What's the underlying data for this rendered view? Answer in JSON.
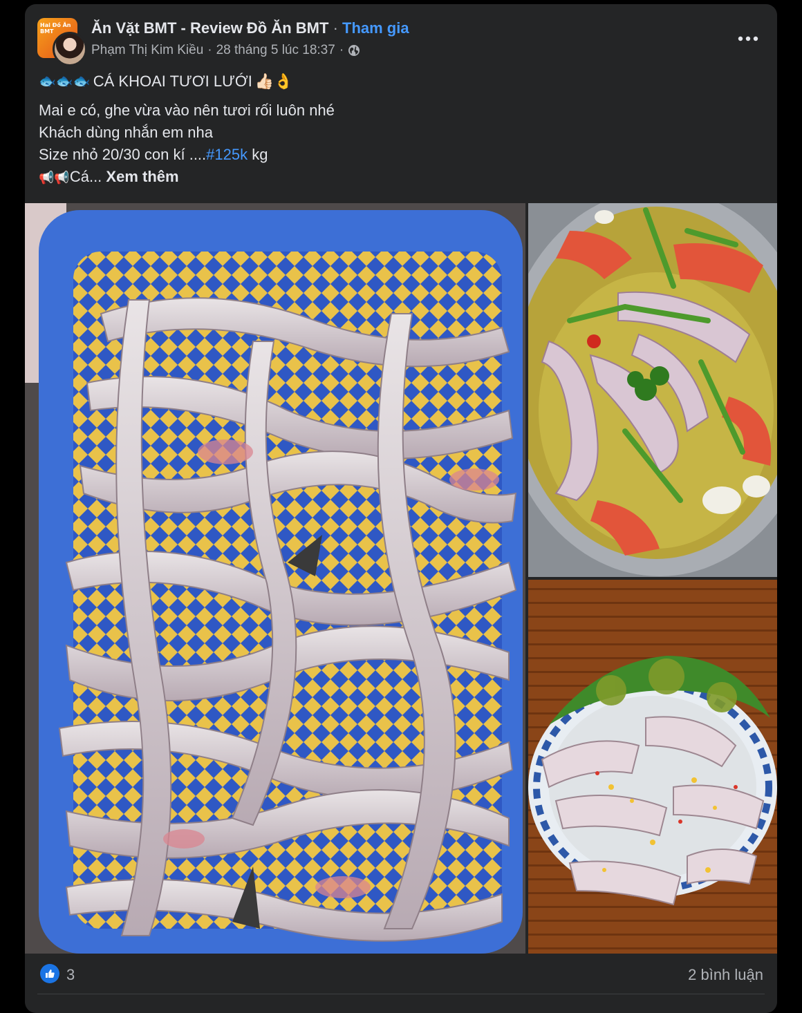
{
  "post": {
    "group_name": "Ăn Vặt BMT - Review Đồ Ăn BMT",
    "separator": " · ",
    "join_label": "Tham gia",
    "author": "Phạm Thị Kim Kiều",
    "timestamp": "28 tháng 5 lúc 18:37",
    "meta_separator": "·",
    "privacy_icon": "globe-icon",
    "more_icon": "more-options-icon",
    "group_avatar_text": "Hai Đồ Ăn BMT",
    "headline_icons": "🐟🐟🐟",
    "headline": "CÁ KHOAI TƯƠI LƯỚI",
    "headline_emoji": "👍🏻👌",
    "lines": [
      "Mai e có, ghe vừa vào nên tươi rối luôn nhé",
      "Khách dùng nhắn em nha"
    ],
    "size_prefix": "Size nhỏ 20/30 con kí ....",
    "hashtag": "#125k",
    "size_suffix": " kg",
    "teaser_icons": "📢📢",
    "teaser": "Cá...",
    "see_more": "Xem thêm"
  },
  "photos": [
    {
      "name": "fresh-fish-basket-photo"
    },
    {
      "name": "fish-soup-photo"
    },
    {
      "name": "fish-plate-photo"
    }
  ],
  "reactions": {
    "like_icon": "like-icon",
    "count": "3",
    "comments": "2 bình luận"
  },
  "colors": {
    "background": "#000000",
    "card": "#242526",
    "text": "#e4e6eb",
    "secondary": "#b0b3b8",
    "link": "#4599ff",
    "like": "#1b74e4"
  }
}
